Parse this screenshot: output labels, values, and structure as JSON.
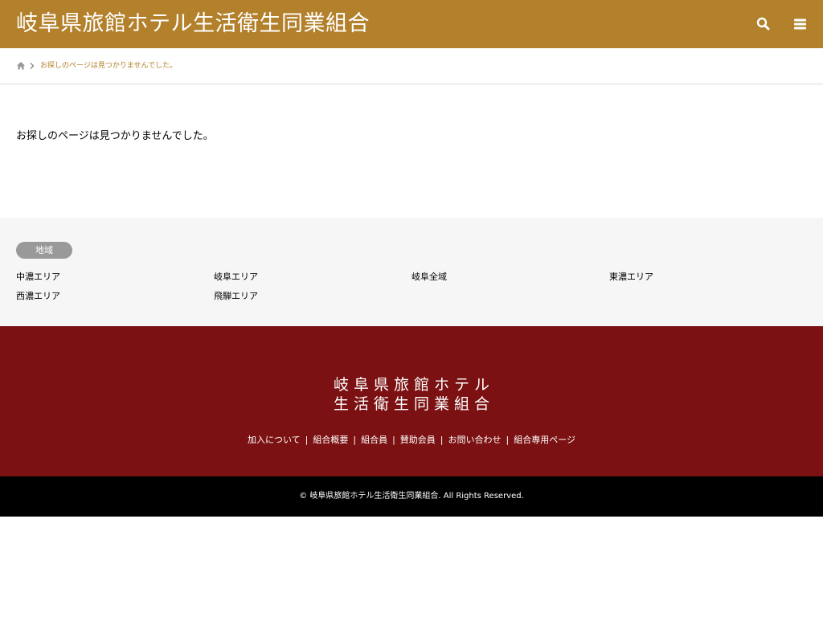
{
  "header": {
    "site_title": "岐阜県旅館ホテル生活衛生同業組合"
  },
  "breadcrumb": {
    "current": "お探しのページは見つかりませんでした。"
  },
  "main": {
    "message": "お探しのページは見つかりませんでした。"
  },
  "widget": {
    "title": "地域",
    "categories": [
      "中濃エリア",
      "岐阜エリア",
      "岐阜全域",
      "東濃エリア",
      "西濃エリア",
      "飛騨エリア"
    ]
  },
  "footer": {
    "logo_line1": "岐阜県旅館ホテル",
    "logo_line2": "生活衛生同業組合",
    "nav": [
      "加入について",
      "組合概要",
      "組合員",
      "賛助会員",
      "お問い合わせ",
      "組合専用ページ"
    ],
    "separator": "|",
    "copyright": "© 岐阜県旅館ホテル生活衛生同業組合. All Rights Reserved."
  },
  "colors": {
    "header_bg": "#b3802b",
    "footer_bg": "#7b1112",
    "copyright_bg": "#000000",
    "widget_bg": "#f6f6f6"
  },
  "icons": {
    "search": "search-icon",
    "menu": "menu-icon",
    "home": "home-icon",
    "separator": "chevron-right-icon"
  }
}
